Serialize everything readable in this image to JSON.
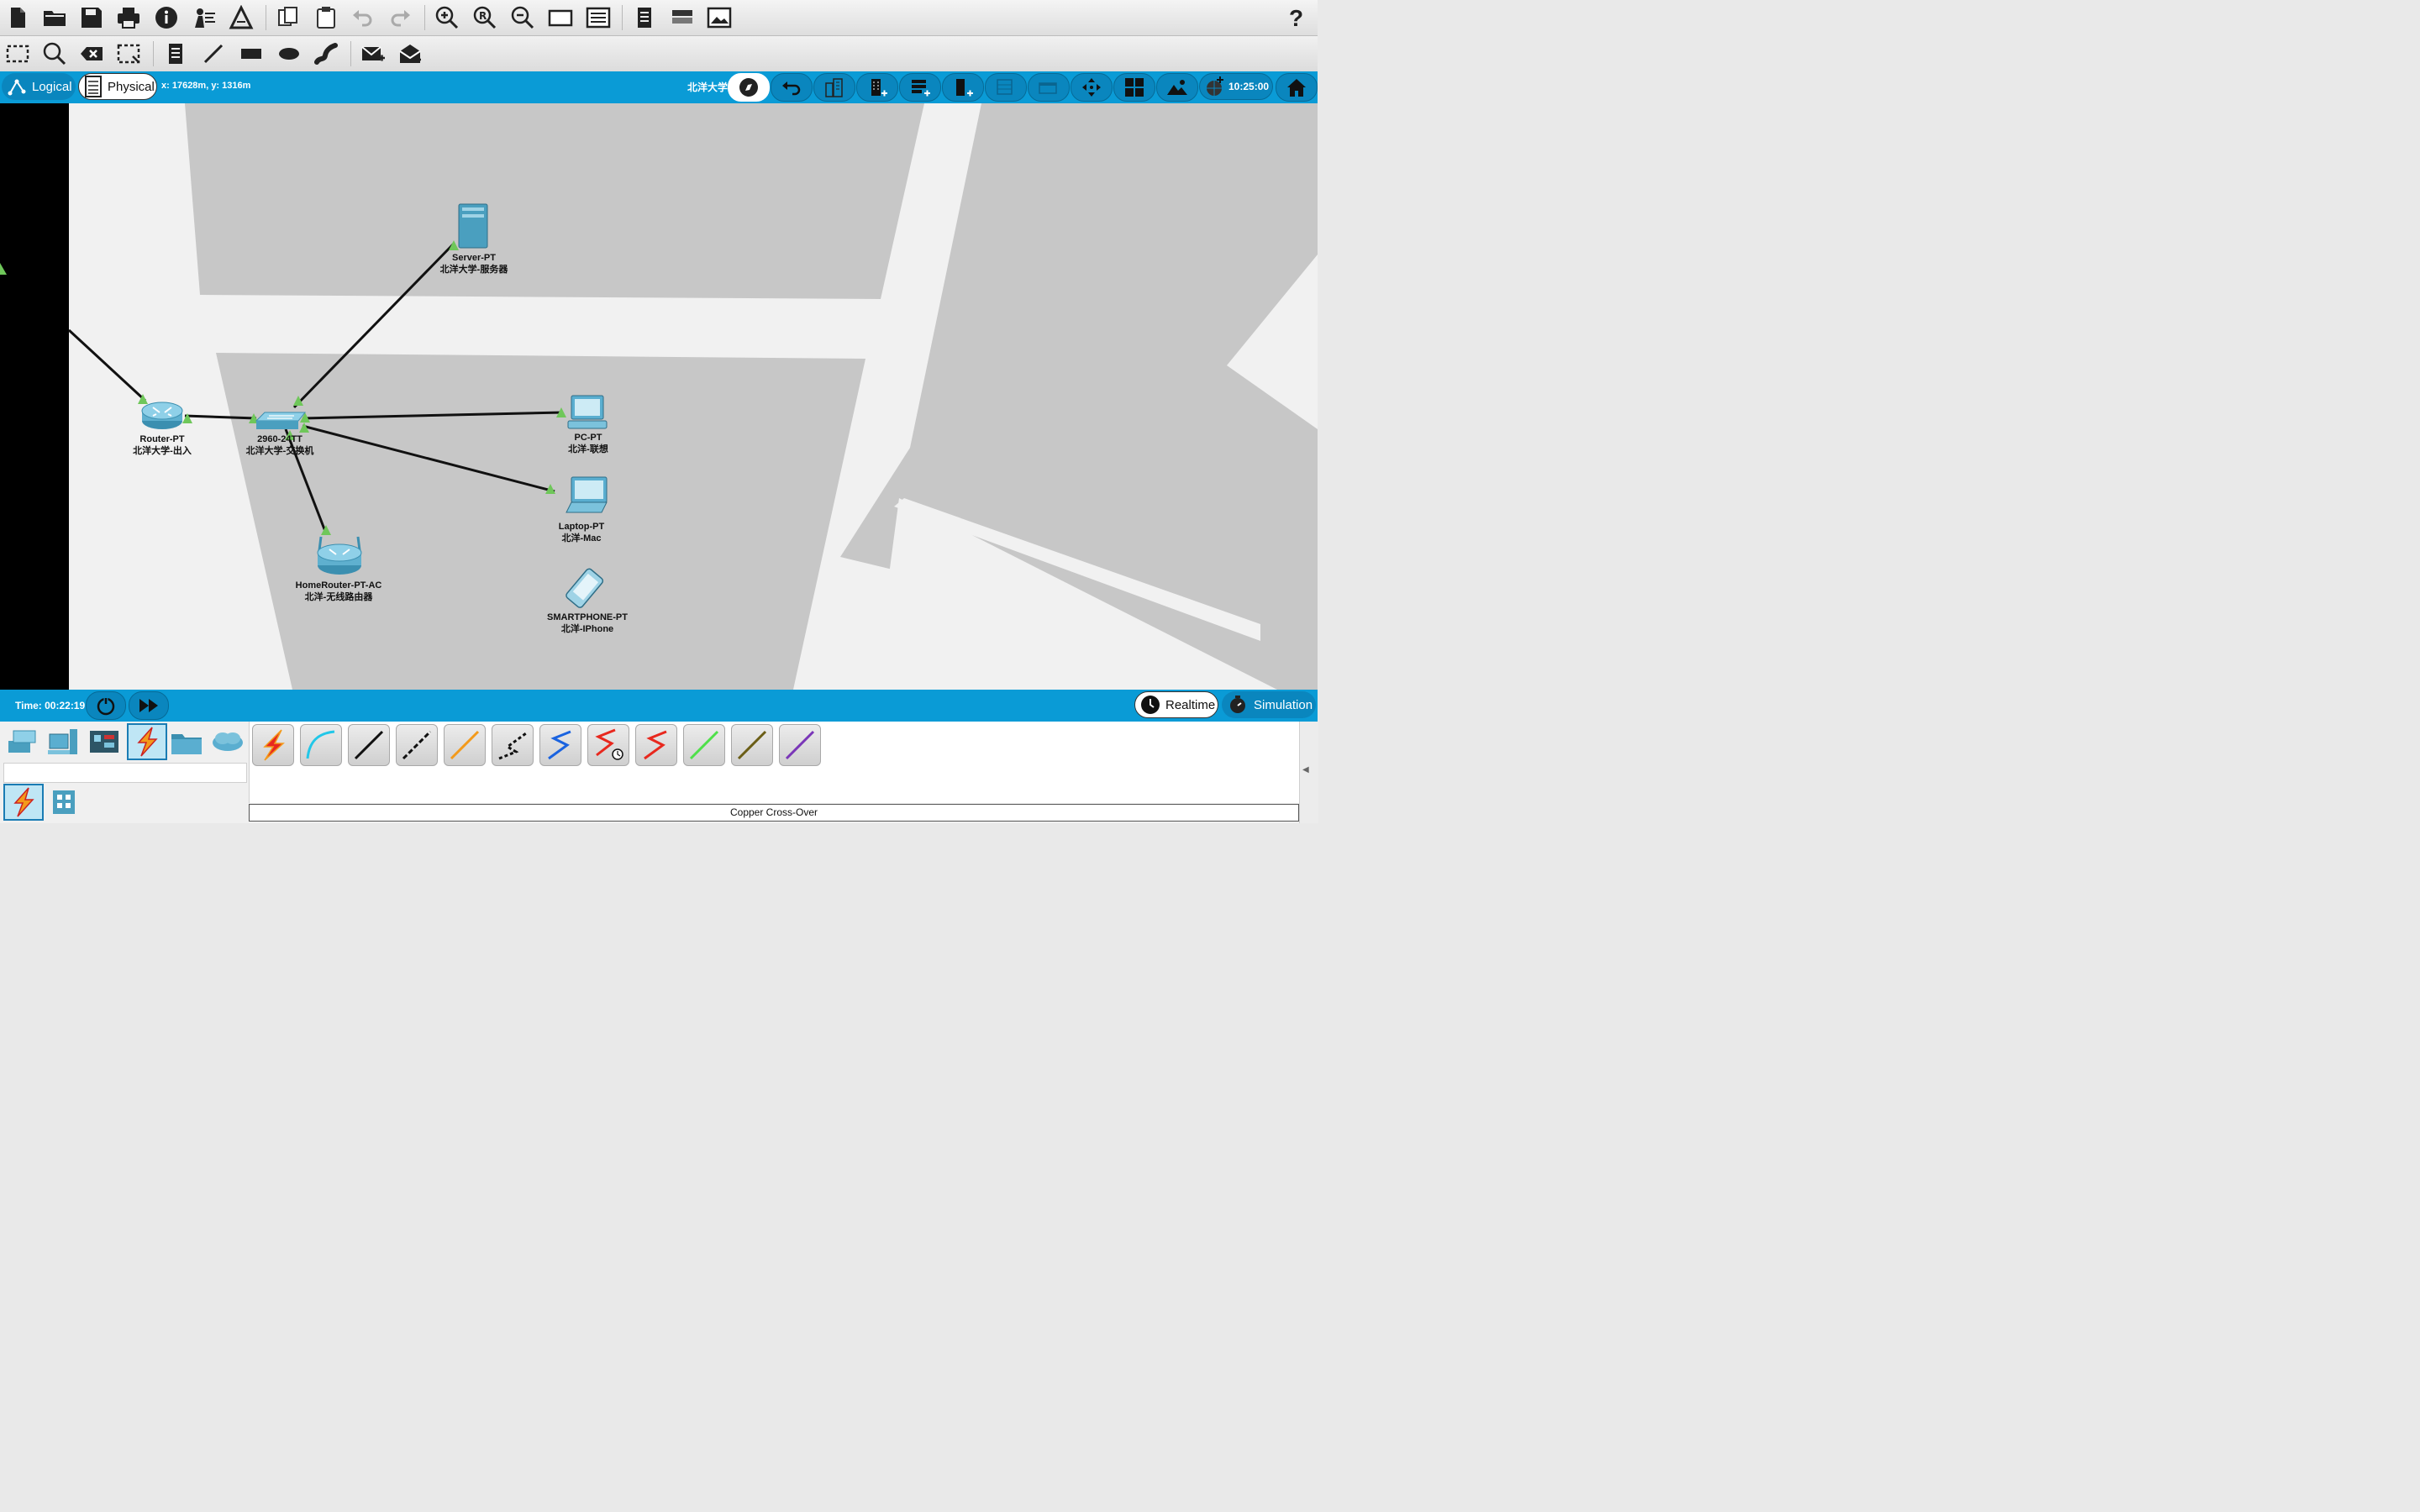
{
  "toolbar_main": {
    "icons": [
      "new-file-icon",
      "open-folder-icon",
      "save-icon",
      "print-icon",
      "info-icon",
      "activity-wizard-icon",
      "pt-builder-icon",
      "copy-icon",
      "paste-icon",
      "undo-icon",
      "redo-icon",
      "zoom-in-icon",
      "zoom-reset-icon",
      "zoom-out-icon",
      "drawing-palette-icon",
      "custom-devices-icon",
      "notes-icon",
      "device-template-icon",
      "image-icon"
    ],
    "help_label": "?"
  },
  "toolbar_edit": {
    "icons": [
      "select-icon",
      "inspect-icon",
      "delete-icon",
      "resize-icon",
      "note-icon",
      "line-icon",
      "rectangle-icon",
      "ellipse-icon",
      "freeform-icon",
      "add-pdu-icon",
      "add-complex-pdu-icon"
    ]
  },
  "view_bar": {
    "logical_label": "Logical",
    "physical_label": "Physical",
    "coordinates": "x: 17628m, y: 1316m",
    "location": "北洋大学",
    "clock": "10:25:00",
    "buttons": [
      "navigation-icon",
      "back-icon",
      "new-city-icon",
      "new-building-icon",
      "new-rack-icon",
      "new-closet-icon",
      "new-container-icon",
      "new-room-icon",
      "move-object-icon",
      "grid-icon",
      "background-icon",
      "set-tiled-background-icon",
      "home-icon"
    ]
  },
  "devices": [
    {
      "model": "Server-PT",
      "name": "北洋大学-服务器"
    },
    {
      "model": "Router-PT",
      "name": "北洋大学-出入"
    },
    {
      "model": "2960-24TT",
      "name": "北洋大学-交换机"
    },
    {
      "model": "PC-PT",
      "name": "北洋-联想"
    },
    {
      "model": "Laptop-PT",
      "name": "北洋-Mac"
    },
    {
      "model": "HomeRouter-PT-AC",
      "name": "北洋-无线路由器"
    },
    {
      "model": "SMARTPHONE-PT",
      "name": "北洋-IPhone"
    }
  ],
  "status_bar": {
    "time": "Time: 00:22:19",
    "realtime_label": "Realtime",
    "simulation_label": "Simulation"
  },
  "device_panel": {
    "categories": [
      "network-devices-icon",
      "end-devices-icon",
      "components-icon",
      "connections-icon",
      "miscellaneous-icon",
      "multiuser-icon"
    ],
    "subcategories": [
      "connections-sub-icon",
      "structured-cabling-icon"
    ],
    "cables": [
      {
        "name": "auto-cable",
        "color": "#e8281e"
      },
      {
        "name": "console-cable",
        "color": "#22c7e8"
      },
      {
        "name": "copper-straight-through",
        "color": "#111111"
      },
      {
        "name": "copper-cross-over",
        "color": "#111111"
      },
      {
        "name": "fiber",
        "color": "#f39a1b"
      },
      {
        "name": "phone",
        "color": "#111111"
      },
      {
        "name": "coaxial",
        "color": "#1a63e0"
      },
      {
        "name": "serial-dce",
        "color": "#e8281e"
      },
      {
        "name": "serial-dte",
        "color": "#e8281e"
      },
      {
        "name": "octal",
        "color": "#4fe04a"
      },
      {
        "name": "iot-custom",
        "color": "#6b5e16"
      },
      {
        "name": "usb",
        "color": "#7a36b8"
      }
    ],
    "selected_cable_label": "Copper Cross-Over"
  }
}
